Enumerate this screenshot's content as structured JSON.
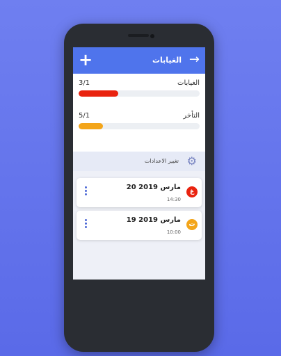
{
  "appbar": {
    "title": "الغيابات",
    "add_icon": "plus-icon",
    "back_icon": "arrow-right-icon"
  },
  "stats": [
    {
      "label": "الغيابات",
      "value": "3/1",
      "fraction": 0.33,
      "color": "#e9230f"
    },
    {
      "label": "التأخر",
      "value": "5/1",
      "fraction": 0.2,
      "color": "#f3a51a"
    }
  ],
  "settings": {
    "label": "تغيير الاعدادات",
    "icon": "gear-icon"
  },
  "entries": [
    {
      "date": "20 مارس 2019",
      "time": "14:30",
      "badge": "غ",
      "badge_color": "#e9230f"
    },
    {
      "date": "19 مارس 2019",
      "time": "10:00",
      "badge": "ت",
      "badge_color": "#f3a51a"
    }
  ]
}
